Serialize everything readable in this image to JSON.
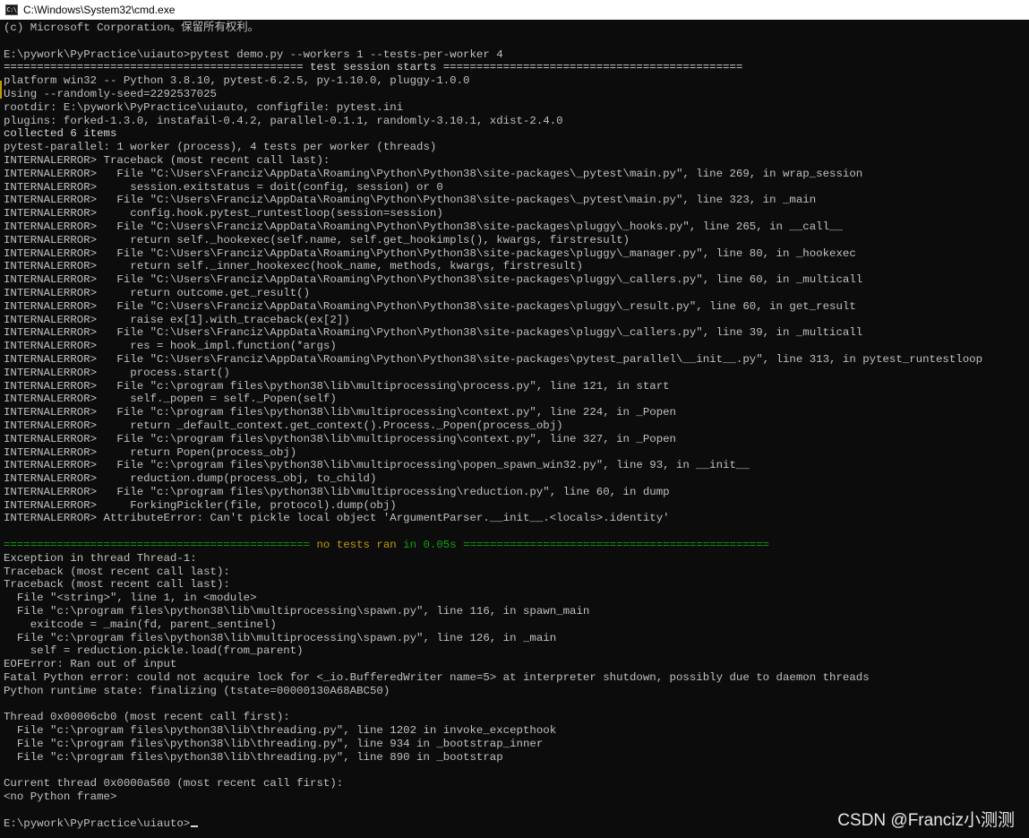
{
  "window": {
    "title": "C:\\Windows\\System32\\cmd.exe",
    "icon": "cmd-icon",
    "icon_text": "C:\\"
  },
  "colors": {
    "background": "#0c0c0c",
    "text": "#c0c0c0",
    "green": "#13a10e",
    "yellow": "#c19c00"
  },
  "console": {
    "lines": [
      [
        {
          "t": "(c) Microsoft Corporation。保留所有权利。"
        }
      ],
      [
        {
          "t": ""
        }
      ],
      [
        {
          "t": "E:\\pywork\\PyPractice\\uiauto>pytest demo.py --workers 1 --tests-per-worker 4"
        }
      ],
      [
        {
          "t": "============================================= test session starts =============================================",
          "c": "white"
        }
      ],
      [
        {
          "t": "platform win32 -- Python 3.8.10, pytest-6.2.5, py-1.10.0, pluggy-1.0.0"
        }
      ],
      [
        {
          "t": "Using --randomly-seed=2292537025"
        }
      ],
      [
        {
          "t": "rootdir: E:\\pywork\\PyPractice\\uiauto, configfile: pytest.ini"
        }
      ],
      [
        {
          "t": "plugins: forked-1.3.0, instafail-0.4.2, parallel-0.1.1, randomly-3.10.1, xdist-2.4.0"
        }
      ],
      [
        {
          "t": "collected 6 items",
          "c": "white"
        }
      ],
      [
        {
          "t": "pytest-parallel: 1 worker (process), 4 tests per worker (threads)"
        }
      ],
      [
        {
          "t": "INTERNALERROR> Traceback (most recent call last):"
        }
      ],
      [
        {
          "t": "INTERNALERROR>   File \"C:\\Users\\Franciz\\AppData\\Roaming\\Python\\Python38\\site-packages\\_pytest\\main.py\", line 269, in wrap_session"
        }
      ],
      [
        {
          "t": "INTERNALERROR>     session.exitstatus = doit(config, session) or 0"
        }
      ],
      [
        {
          "t": "INTERNALERROR>   File \"C:\\Users\\Franciz\\AppData\\Roaming\\Python\\Python38\\site-packages\\_pytest\\main.py\", line 323, in _main"
        }
      ],
      [
        {
          "t": "INTERNALERROR>     config.hook.pytest_runtestloop(session=session)"
        }
      ],
      [
        {
          "t": "INTERNALERROR>   File \"C:\\Users\\Franciz\\AppData\\Roaming\\Python\\Python38\\site-packages\\pluggy\\_hooks.py\", line 265, in __call__"
        }
      ],
      [
        {
          "t": "INTERNALERROR>     return self._hookexec(self.name, self.get_hookimpls(), kwargs, firstresult)"
        }
      ],
      [
        {
          "t": "INTERNALERROR>   File \"C:\\Users\\Franciz\\AppData\\Roaming\\Python\\Python38\\site-packages\\pluggy\\_manager.py\", line 80, in _hookexec"
        }
      ],
      [
        {
          "t": "INTERNALERROR>     return self._inner_hookexec(hook_name, methods, kwargs, firstresult)"
        }
      ],
      [
        {
          "t": "INTERNALERROR>   File \"C:\\Users\\Franciz\\AppData\\Roaming\\Python\\Python38\\site-packages\\pluggy\\_callers.py\", line 60, in _multicall"
        }
      ],
      [
        {
          "t": "INTERNALERROR>     return outcome.get_result()"
        }
      ],
      [
        {
          "t": "INTERNALERROR>   File \"C:\\Users\\Franciz\\AppData\\Roaming\\Python\\Python38\\site-packages\\pluggy\\_result.py\", line 60, in get_result"
        }
      ],
      [
        {
          "t": "INTERNALERROR>     raise ex[1].with_traceback(ex[2])"
        }
      ],
      [
        {
          "t": "INTERNALERROR>   File \"C:\\Users\\Franciz\\AppData\\Roaming\\Python\\Python38\\site-packages\\pluggy\\_callers.py\", line 39, in _multicall"
        }
      ],
      [
        {
          "t": "INTERNALERROR>     res = hook_impl.function(*args)"
        }
      ],
      [
        {
          "t": "INTERNALERROR>   File \"C:\\Users\\Franciz\\AppData\\Roaming\\Python\\Python38\\site-packages\\pytest_parallel\\__init__.py\", line 313, in pytest_runtestloop"
        }
      ],
      [
        {
          "t": "INTERNALERROR>     process.start()"
        }
      ],
      [
        {
          "t": "INTERNALERROR>   File \"c:\\program files\\python38\\lib\\multiprocessing\\process.py\", line 121, in start"
        }
      ],
      [
        {
          "t": "INTERNALERROR>     self._popen = self._Popen(self)"
        }
      ],
      [
        {
          "t": "INTERNALERROR>   File \"c:\\program files\\python38\\lib\\multiprocessing\\context.py\", line 224, in _Popen"
        }
      ],
      [
        {
          "t": "INTERNALERROR>     return _default_context.get_context().Process._Popen(process_obj)"
        }
      ],
      [
        {
          "t": "INTERNALERROR>   File \"c:\\program files\\python38\\lib\\multiprocessing\\context.py\", line 327, in _Popen"
        }
      ],
      [
        {
          "t": "INTERNALERROR>     return Popen(process_obj)"
        }
      ],
      [
        {
          "t": "INTERNALERROR>   File \"c:\\program files\\python38\\lib\\multiprocessing\\popen_spawn_win32.py\", line 93, in __init__"
        }
      ],
      [
        {
          "t": "INTERNALERROR>     reduction.dump(process_obj, to_child)"
        }
      ],
      [
        {
          "t": "INTERNALERROR>   File \"c:\\program files\\python38\\lib\\multiprocessing\\reduction.py\", line 60, in dump"
        }
      ],
      [
        {
          "t": "INTERNALERROR>     ForkingPickler(file, protocol).dump(obj)"
        }
      ],
      [
        {
          "t": "INTERNALERROR> AttributeError: Can't pickle local object 'ArgumentParser.__init__.<locals>.identity'"
        }
      ],
      [
        {
          "t": ""
        }
      ],
      [
        {
          "t": "============================================== ",
          "c": "green"
        },
        {
          "t": "no tests ran",
          "c": "yellow"
        },
        {
          "t": " in 0.05s ==============================================",
          "c": "green"
        }
      ],
      [
        {
          "t": "Exception in thread Thread-1:"
        }
      ],
      [
        {
          "t": "Traceback (most recent call last):"
        }
      ],
      [
        {
          "t": "Traceback (most recent call last):"
        }
      ],
      [
        {
          "t": "  File \"<string>\", line 1, in <module>"
        }
      ],
      [
        {
          "t": "  File \"c:\\program files\\python38\\lib\\multiprocessing\\spawn.py\", line 116, in spawn_main"
        }
      ],
      [
        {
          "t": "    exitcode = _main(fd, parent_sentinel)"
        }
      ],
      [
        {
          "t": "  File \"c:\\program files\\python38\\lib\\multiprocessing\\spawn.py\", line 126, in _main"
        }
      ],
      [
        {
          "t": "    self = reduction.pickle.load(from_parent)"
        }
      ],
      [
        {
          "t": "EOFError: Ran out of input"
        }
      ],
      [
        {
          "t": "Fatal Python error: could not acquire lock for <_io.BufferedWriter name=5> at interpreter shutdown, possibly due to daemon threads"
        }
      ],
      [
        {
          "t": "Python runtime state: finalizing (tstate=00000130A68ABC50)"
        }
      ],
      [
        {
          "t": ""
        }
      ],
      [
        {
          "t": "Thread 0x00006cb0 (most recent call first):"
        }
      ],
      [
        {
          "t": "  File \"c:\\program files\\python38\\lib\\threading.py\", line 1202 in invoke_excepthook"
        }
      ],
      [
        {
          "t": "  File \"c:\\program files\\python38\\lib\\threading.py\", line 934 in _bootstrap_inner"
        }
      ],
      [
        {
          "t": "  File \"c:\\program files\\python38\\lib\\threading.py\", line 890 in _bootstrap"
        }
      ],
      [
        {
          "t": ""
        }
      ],
      [
        {
          "t": "Current thread 0x0000a560 (most recent call first):"
        }
      ],
      [
        {
          "t": "<no Python frame>"
        }
      ],
      [
        {
          "t": ""
        }
      ],
      [
        {
          "t": "E:\\pywork\\PyPractice\\uiauto>",
          "cursor": true
        }
      ]
    ]
  },
  "watermark": "CSDN @Franciz小测测"
}
